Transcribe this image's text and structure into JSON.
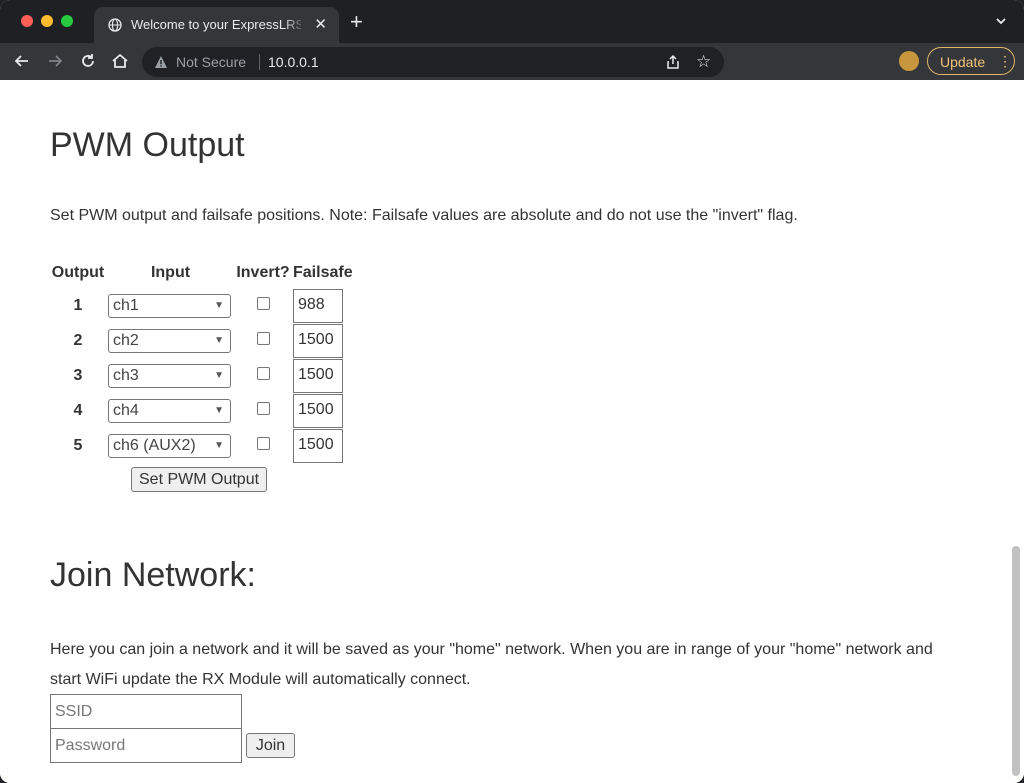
{
  "browser": {
    "tab_title": "Welcome to your ExpressLRS S",
    "tab_close": "✕",
    "new_tab": "+",
    "security_label": "Not Secure",
    "url": "10.0.0.1",
    "update_label": "Update"
  },
  "pwm": {
    "heading": "PWM Output",
    "description": "Set PWM output and failsafe positions. Note: Failsafe values are absolute and do not use the \"invert\" flag.",
    "columns": [
      "Output",
      "Input",
      "Invert?",
      "Failsafe"
    ],
    "rows": [
      {
        "output": "1",
        "input": "ch1",
        "inverted": false,
        "failsafe": "988"
      },
      {
        "output": "2",
        "input": "ch2",
        "inverted": false,
        "failsafe": "1500"
      },
      {
        "output": "3",
        "input": "ch3",
        "inverted": false,
        "failsafe": "1500"
      },
      {
        "output": "4",
        "input": "ch4",
        "inverted": false,
        "failsafe": "1500"
      },
      {
        "output": "5",
        "input": "ch6 (AUX2)",
        "inverted": false,
        "failsafe": "1500"
      }
    ],
    "submit_label": "Set PWM Output"
  },
  "join": {
    "heading": "Join Network:",
    "description": "Here you can join a network and it will be saved as your \"home\" network. When you are in range of your \"home\" network and start WiFi update the RX Module will automatically connect.",
    "ssid_placeholder": "SSID",
    "password_placeholder": "Password",
    "join_label": "Join"
  },
  "colors": {
    "tab_strip": "#1f2023",
    "toolbar": "#35363a",
    "update_accent": "#f1c27a"
  }
}
